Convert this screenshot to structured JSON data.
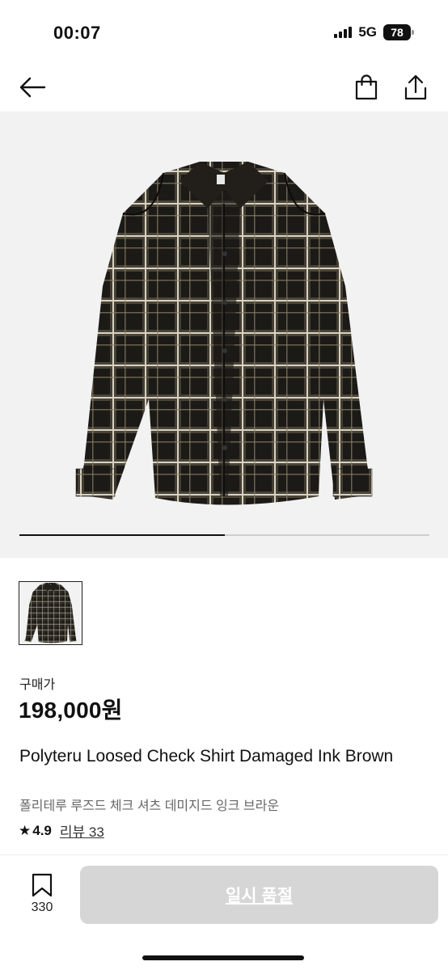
{
  "status_bar": {
    "time": "00:07",
    "network": "5G",
    "battery": "78"
  },
  "nav": {
    "back_icon": "arrow-left-icon",
    "bag_icon": "shopping-bag-icon",
    "share_icon": "share-icon"
  },
  "hero": {
    "image": "plaid-shirt-product-photo",
    "carousel_progress": 0.5
  },
  "product": {
    "price_label": "구매가",
    "price": "198,000원",
    "name": "Polyteru Loosed Check Shirt Damaged Ink Brown",
    "name_ko": "폴리테루 루즈드 체크 셔츠 데미지드 잉크 브라운",
    "rating_star": "★",
    "rating": "4.9",
    "review_link": "리뷰 33"
  },
  "bottom_bar": {
    "bookmark_icon": "bookmark-icon",
    "bookmark_count": "330",
    "cta_label": "일시 품절"
  },
  "colors": {
    "hero_bg": "#f2f2f2",
    "cta_disabled": "#d6d6d6"
  }
}
